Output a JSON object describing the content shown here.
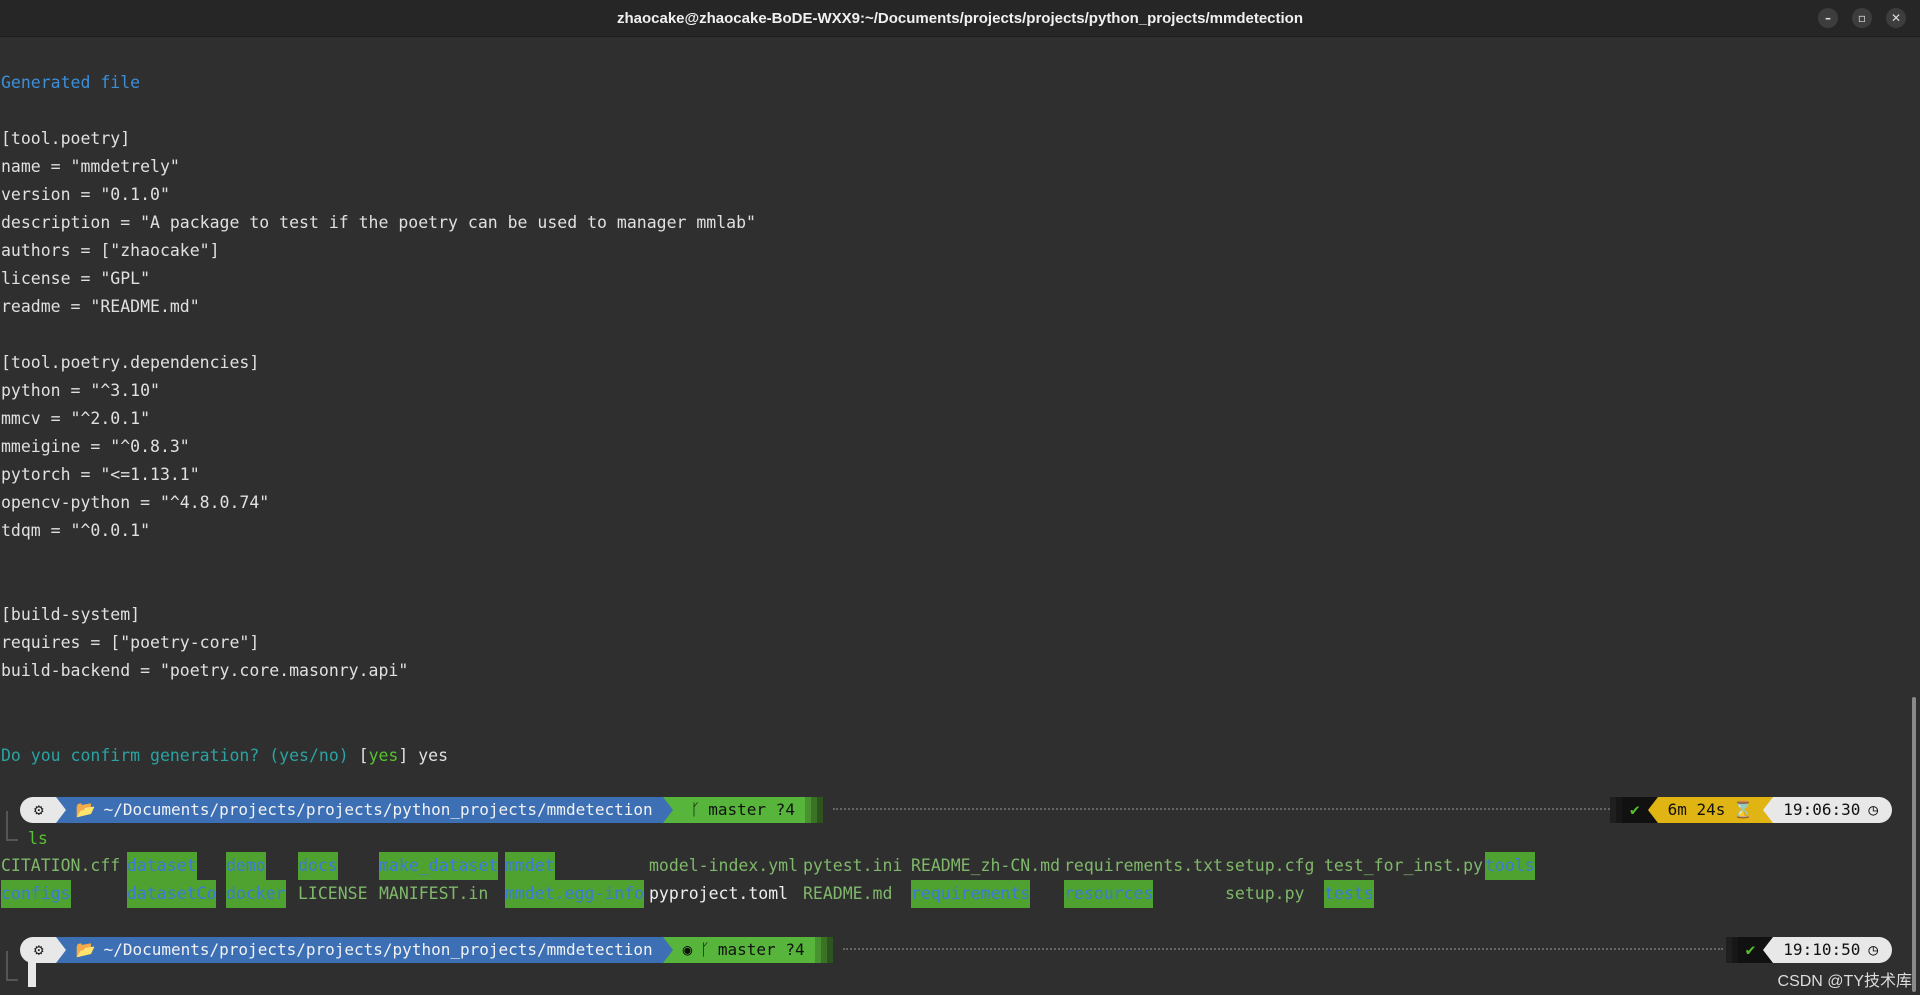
{
  "window": {
    "title": "zhaocake@zhaocake-BoDE-WXX9:~/Documents/projects/projects/python_projects/mmdetection",
    "min_glyph": "–",
    "max_glyph": "▫",
    "close_glyph": "✕"
  },
  "output": {
    "generated": "Generated file",
    "toml_lines": [
      "[tool.poetry]",
      "name = \"mmdetrely\"",
      "version = \"0.1.0\"",
      "description = \"A package to test if the poetry can be used to manager mmlab\"",
      "authors = [\"zhaocake\"]",
      "license = \"GPL\"",
      "readme = \"README.md\"",
      "",
      "[tool.poetry.dependencies]",
      "python = \"^3.10\"",
      "mmcv = \"^2.0.1\"",
      "mmeigine = \"^0.8.3\"",
      "pytorch = \"<=1.13.1\"",
      "opencv-python = \"^4.8.0.74\"",
      "tdqm = \"^0.0.1\"",
      "",
      "",
      "[build-system]",
      "requires = [\"poetry-core\"]",
      "build-backend = \"poetry.core.masonry.api\""
    ],
    "confirm_question": "Do you confirm generation? (yes/no) ",
    "confirm_open": "[",
    "confirm_default": "yes",
    "confirm_close": "] ",
    "confirm_answer": "yes"
  },
  "prompt1": {
    "os_icon": "⚙",
    "folder_icon": "📂",
    "path": "~/Documents/projects/projects/python_projects/mmdetection",
    "git_icon": "",
    "branch_icon": "ᚴ",
    "branch": "master ?4",
    "ok": "✔",
    "duration": "6m 24s",
    "duration_icon": "⌛",
    "time": "19:06:30",
    "clock_icon": "◷"
  },
  "command": "ls",
  "ls": {
    "row1": [
      {
        "name": "CITATION.cff",
        "kind": "file"
      },
      {
        "name": "dataset",
        "kind": "dir"
      },
      {
        "name": "demo",
        "kind": "dir"
      },
      {
        "name": "docs",
        "kind": "dir"
      },
      {
        "name": "make_dataset",
        "kind": "dir"
      },
      {
        "name": "mmdet",
        "kind": "dir"
      },
      {
        "name": "model-index.yml",
        "kind": "file"
      },
      {
        "name": "pytest.ini",
        "kind": "file"
      },
      {
        "name": "README_zh-CN.md",
        "kind": "file"
      },
      {
        "name": "requirements.txt",
        "kind": "file"
      },
      {
        "name": "setup.cfg",
        "kind": "file"
      },
      {
        "name": "test_for_inst.py",
        "kind": "file"
      },
      {
        "name": "tools",
        "kind": "dir"
      }
    ],
    "row2": [
      {
        "name": "configs",
        "kind": "dir"
      },
      {
        "name": "datasetCo",
        "kind": "dir"
      },
      {
        "name": "docker",
        "kind": "dir"
      },
      {
        "name": "LICENSE",
        "kind": "file"
      },
      {
        "name": "MANIFEST.in",
        "kind": "file"
      },
      {
        "name": "mmdet.egg-info",
        "kind": "dir"
      },
      {
        "name": "pyproject.toml",
        "kind": "plain"
      },
      {
        "name": "README.md",
        "kind": "file"
      },
      {
        "name": "requirements",
        "kind": "dir"
      },
      {
        "name": "resources",
        "kind": "dir"
      },
      {
        "name": "setup.py",
        "kind": "file"
      },
      {
        "name": "tests",
        "kind": "dir"
      }
    ]
  },
  "prompt2": {
    "path": "~/Documents/projects/projects/python_projects/mmdetection",
    "branch": "master ?4",
    "ok": "✔",
    "time": "19:10:50"
  },
  "watermark": "CSDN @TY技术库",
  "colors": {
    "background": "#2f2f2f",
    "dir_segment": "#3d6fb5",
    "git_segment": "#56b53a",
    "duration_segment": "#e0b513",
    "info_blue": "#3b8fd9"
  }
}
